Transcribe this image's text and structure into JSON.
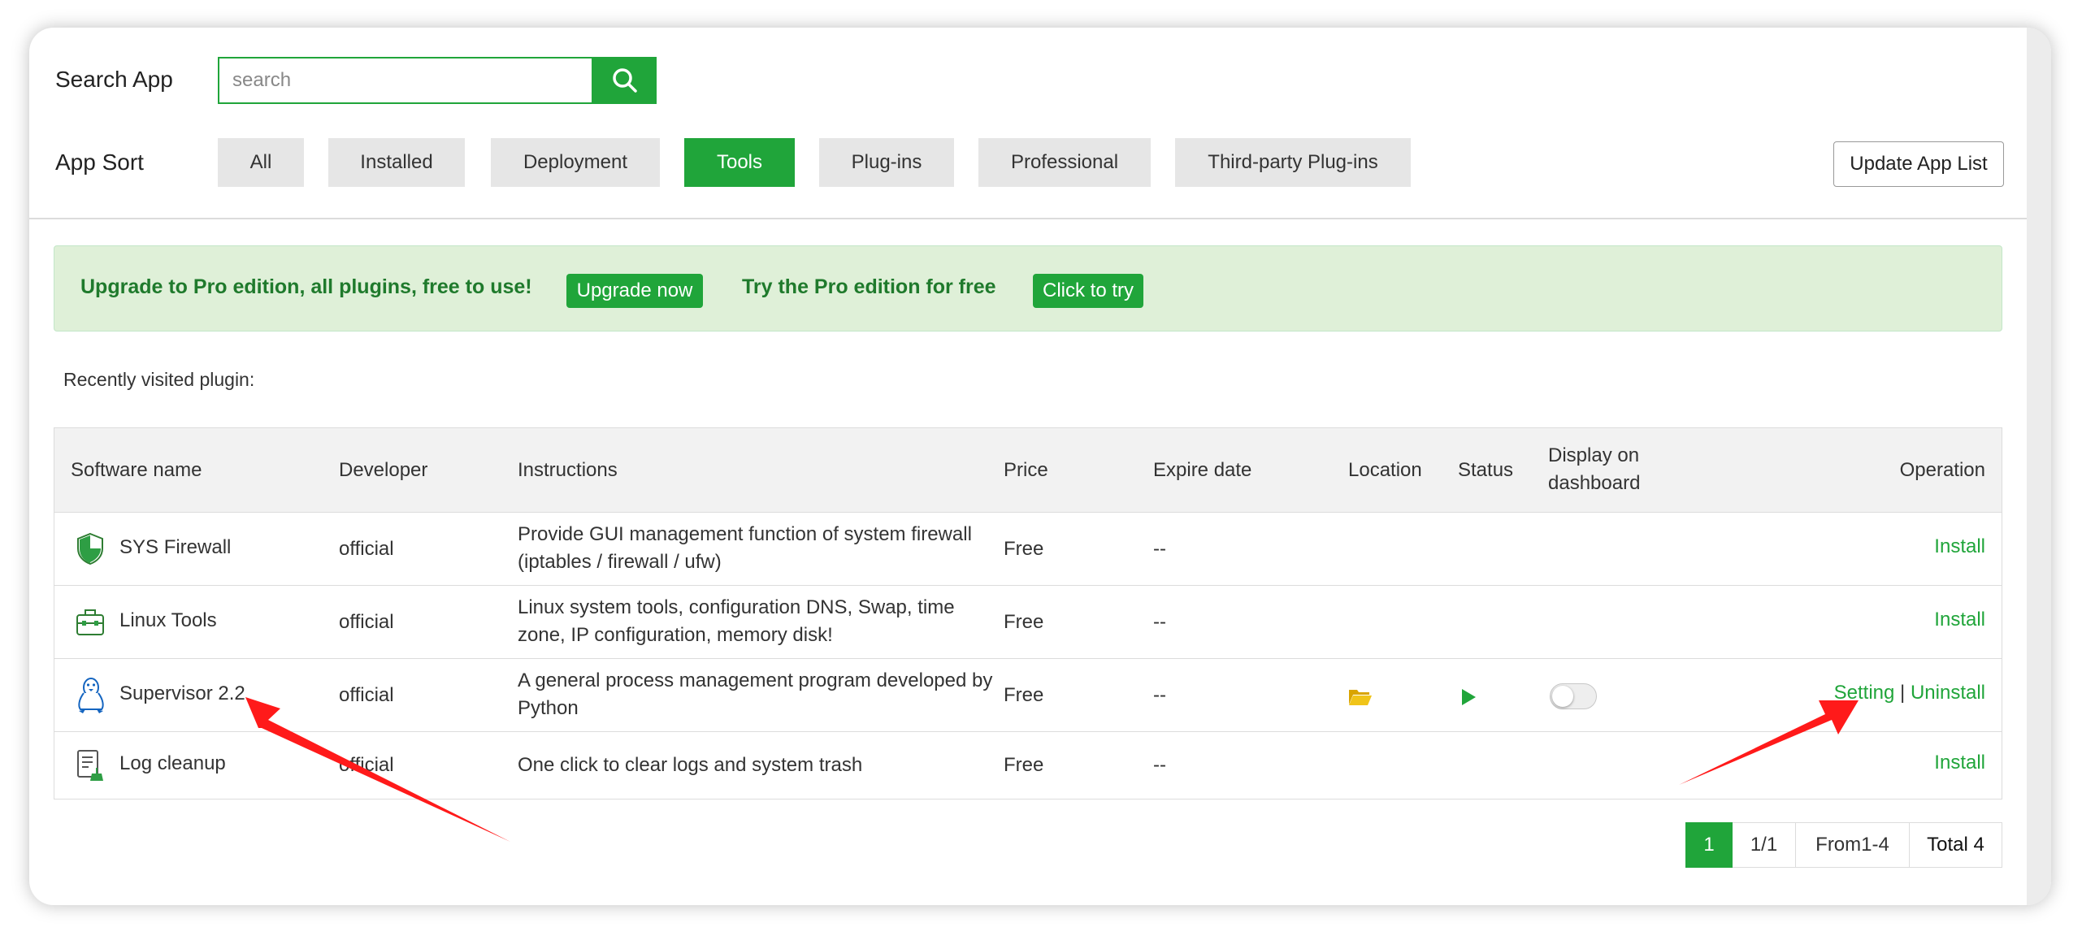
{
  "search": {
    "label": "Search App",
    "placeholder": "search",
    "icon": "search-icon"
  },
  "sort": {
    "label": "App Sort",
    "tabs": [
      "All",
      "Installed",
      "Deployment",
      "Tools",
      "Plug-ins",
      "Professional",
      "Third-party Plug-ins"
    ],
    "active": "Tools"
  },
  "update_button": "Update App List",
  "banner": {
    "text1": "Upgrade to Pro edition, all plugins, free to use!",
    "btn1": "Upgrade now",
    "text2": "Try the Pro edition for free",
    "btn2": "Click to try"
  },
  "recent_label": "Recently visited plugin:",
  "table": {
    "headers": {
      "name": "Software name",
      "developer": "Developer",
      "instructions": "Instructions",
      "price": "Price",
      "expire": "Expire date",
      "location": "Location",
      "status": "Status",
      "display_line1": "Display on",
      "display_line2": "dashboard",
      "operation": "Operation"
    },
    "rows": [
      {
        "name": "SYS Firewall",
        "icon": "shield-icon",
        "developer": "official",
        "instructions": "Provide GUI management function of system firewall (iptables / firewall / ufw)",
        "price": "Free",
        "expire": "--",
        "op": "Install"
      },
      {
        "name": "Linux Tools",
        "icon": "toolbox-icon",
        "developer": "official",
        "instructions": "Linux system tools, configuration DNS, Swap, time zone, IP configuration, memory disk!",
        "price": "Free",
        "expire": "--",
        "op": "Install"
      },
      {
        "name": "Supervisor 2.2",
        "icon": "penguin-icon",
        "developer": "official",
        "instructions": "A general process management program developed by Python",
        "price": "Free",
        "expire": "--",
        "op_setting": "Setting",
        "op_sep": "|",
        "op_uninstall": "Uninstall",
        "location_icon": "folder-icon",
        "status_icon": "play-icon",
        "dashboard_toggle": false
      },
      {
        "name": "Log cleanup",
        "icon": "log-cleanup-icon",
        "developer": "official",
        "instructions": "One click to clear logs and system trash",
        "price": "Free",
        "expire": "--",
        "op": "Install"
      }
    ]
  },
  "pagination": {
    "current": "1",
    "pages": "1/1",
    "range": "From1-4",
    "total": "Total 4"
  },
  "colors": {
    "accent": "#20a53a",
    "banner_bg": "#dff0d8",
    "banner_text": "#1f7a2c",
    "annotation": "#ff1a1a"
  }
}
